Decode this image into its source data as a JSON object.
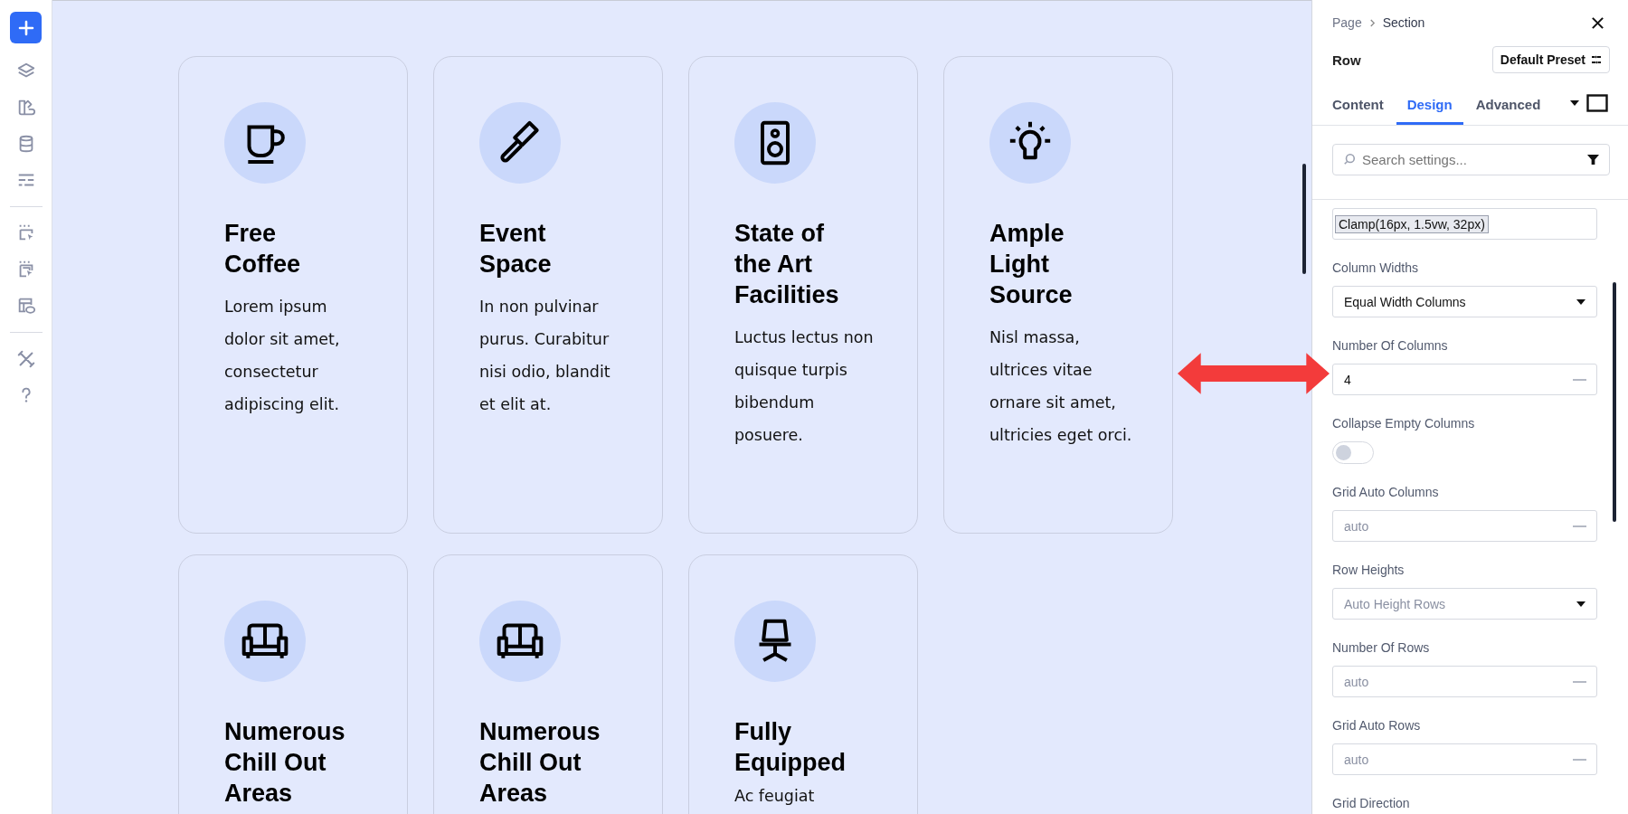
{
  "cards": [
    {
      "kind": "coffee",
      "title": "Free Coffee",
      "body": "Lorem ipsum dolor sit amet, consectetur adipiscing elit."
    },
    {
      "kind": "brush",
      "title": "Event Space",
      "body": "In non pulvinar purus. Curabitur nisi odio, blandit et elit at."
    },
    {
      "kind": "speaker",
      "title": "State of the Art Facilities",
      "body": "Luctus lectus non quisque turpis bibendum posuere."
    },
    {
      "kind": "bulb",
      "title": "Ample Light Source",
      "body": "Nisl massa, ultrices vitae ornare sit amet, ultricies eget orci."
    },
    {
      "kind": "sofa",
      "title": "Numerous Chill Out Areas"
    },
    {
      "kind": "sofa",
      "title": "Numerous Chill Out Areas"
    },
    {
      "kind": "chair",
      "title": "Fully Equipped",
      "body": "Ac feugiat"
    }
  ],
  "panel": {
    "breadcrumb": [
      "Page",
      "Section"
    ],
    "title": "Row",
    "preset_button": "Default Preset",
    "tabs": [
      {
        "label": "Content",
        "selected": false
      },
      {
        "label": "Design",
        "selected": true
      },
      {
        "label": "Advanced",
        "selected": false
      }
    ],
    "search": {
      "placeholder": "Search settings..."
    },
    "settings": [
      {
        "kind": "token",
        "value": "Clamp(16px, 1.5vw, 32px)"
      },
      {
        "kind": "select",
        "label": "Column Widths",
        "value": "Equal Width Columns"
      },
      {
        "kind": "input",
        "label": "Number Of Columns",
        "value": "4"
      },
      {
        "kind": "toggle",
        "label": "Collapse Empty Columns",
        "on": false
      },
      {
        "kind": "input",
        "label": "Grid Auto Columns",
        "placeholder": "auto"
      },
      {
        "kind": "select",
        "label": "Row Heights",
        "placeholder": "Auto Height Rows"
      },
      {
        "kind": "input",
        "label": "Number Of Rows",
        "placeholder": "auto"
      },
      {
        "kind": "input",
        "label": "Grid Auto Rows",
        "placeholder": "auto"
      },
      {
        "kind": "label",
        "label": "Grid Direction"
      }
    ]
  }
}
